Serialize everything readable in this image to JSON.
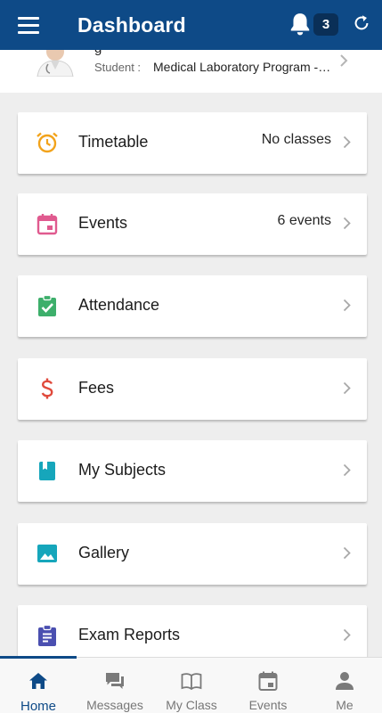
{
  "header": {
    "title": "Dashboard",
    "notification_count": "3",
    "menu_icon": "hamburger-menu-icon",
    "bell_icon": "bell-icon",
    "refresh_icon": "refresh-icon"
  },
  "profile": {
    "name": "g",
    "role_label": "Student :",
    "program": "Medical Laboratory Program - ..."
  },
  "cards": [
    {
      "label": "Timetable",
      "value": "No classes",
      "icon": "alarm-clock-icon",
      "color": "#f2a31b"
    },
    {
      "label": "Events",
      "value": "6 events",
      "icon": "calendar-icon",
      "color": "#e05a8f"
    },
    {
      "label": "Attendance",
      "value": "",
      "icon": "clipboard-check-icon",
      "color": "#3daf6b"
    },
    {
      "label": "Fees",
      "value": "",
      "icon": "dollar-icon",
      "color": "#e04a3c"
    },
    {
      "label": "My Subjects",
      "value": "",
      "icon": "book-icon",
      "color": "#16a6bb"
    },
    {
      "label": "Gallery",
      "value": "",
      "icon": "image-icon",
      "color": "#16a6bb"
    },
    {
      "label": "Exam Reports",
      "value": "",
      "icon": "report-clipboard-icon",
      "color": "#4a4fb0"
    }
  ],
  "bottom_nav": [
    {
      "label": "Home",
      "icon": "home-icon",
      "active": true
    },
    {
      "label": "Messages",
      "icon": "chat-icon",
      "active": false
    },
    {
      "label": "My Class",
      "icon": "open-book-icon",
      "active": false
    },
    {
      "label": "Events",
      "icon": "calendar-icon",
      "active": false
    },
    {
      "label": "Me",
      "icon": "person-icon",
      "active": false
    }
  ],
  "colors": {
    "primary": "#0e4a87",
    "background": "#eeeeee"
  }
}
